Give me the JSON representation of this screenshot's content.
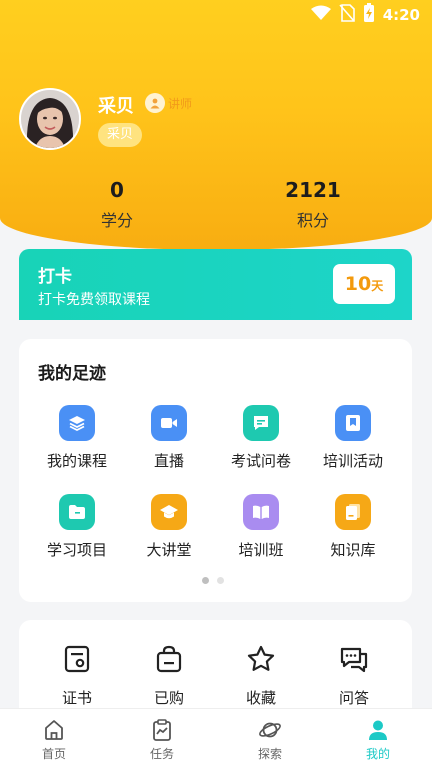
{
  "status_bar": {
    "time": "4:20"
  },
  "profile": {
    "name": "采贝",
    "role_label": "讲师",
    "name_tag": "采贝",
    "stats": [
      {
        "value": "0",
        "label": "学分"
      },
      {
        "value": "2121",
        "label": "积分"
      }
    ]
  },
  "checkin": {
    "title": "打卡",
    "subtitle": "打卡免费领取课程",
    "days": "10",
    "days_unit": "天"
  },
  "footprint": {
    "title": "我的足迹",
    "items": [
      {
        "label": "我的课程",
        "icon": "layers-icon",
        "color": "#4a90f5"
      },
      {
        "label": "直播",
        "icon": "video-camera-icon",
        "color": "#4a90f5"
      },
      {
        "label": "考试问卷",
        "icon": "message-icon",
        "color": "#1ec9b0"
      },
      {
        "label": "培训活动",
        "icon": "bookmark-icon",
        "color": "#4a90f5"
      },
      {
        "label": "学习项目",
        "icon": "folder-icon",
        "color": "#1ec9b0"
      },
      {
        "label": "大讲堂",
        "icon": "graduation-cap-icon",
        "color": "#f6a816"
      },
      {
        "label": "培训班",
        "icon": "book-icon",
        "color": "#a98cf0"
      },
      {
        "label": "知识库",
        "icon": "documents-icon",
        "color": "#f6a816"
      }
    ]
  },
  "services": {
    "items": [
      {
        "label": "证书",
        "icon": "certificate-icon"
      },
      {
        "label": "已购",
        "icon": "shopping-bag-icon"
      },
      {
        "label": "收藏",
        "icon": "star-icon"
      },
      {
        "label": "问答",
        "icon": "chat-icon"
      }
    ]
  },
  "tabbar": {
    "items": [
      {
        "label": "首页",
        "icon": "home-icon"
      },
      {
        "label": "任务",
        "icon": "task-icon"
      },
      {
        "label": "探索",
        "icon": "planet-icon"
      },
      {
        "label": "我的",
        "icon": "user-icon"
      }
    ],
    "active_color": "#1cc9c6"
  }
}
